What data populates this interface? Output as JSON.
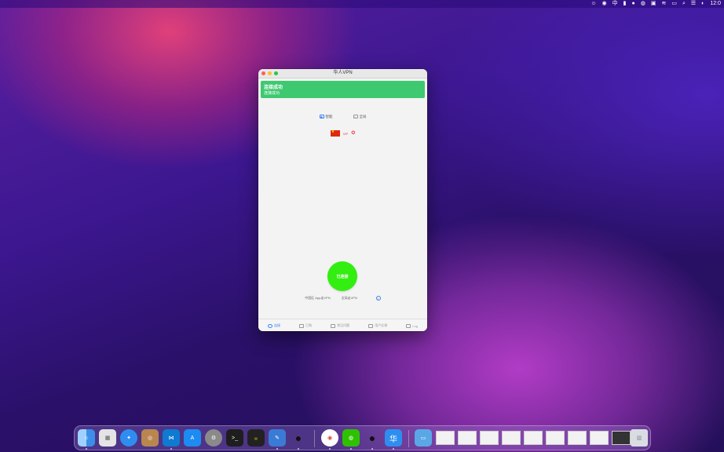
{
  "menubar": {
    "input_method": "中",
    "clock": "12:0"
  },
  "window": {
    "title": "华人VPN",
    "banner": {
      "title": "连接成功",
      "subtitle": "连接成功"
    },
    "modes": [
      {
        "label": "智能",
        "icon": "smart-mode-icon",
        "selected": true
      },
      {
        "label": "全局",
        "icon": "global-mode-icon",
        "selected": false
      }
    ],
    "server": {
      "country_flag": "china-flag-icon",
      "label": "VIP"
    },
    "connect_button": {
      "label": "已连接"
    },
    "hints": [
      {
        "label": "中国区 App走VPN"
      },
      {
        "label": "全局走VPN"
      }
    ],
    "tabs": [
      {
        "label": "连接",
        "active": true
      },
      {
        "label": "已购"
      },
      {
        "label": "常见问题"
      },
      {
        "label": "用户反馈"
      },
      {
        "label": "Log"
      }
    ]
  },
  "dock": {
    "colors": {
      "finder": "#3b8fe8",
      "launchpad": "#e4e4e4",
      "safari": "#2f8df0",
      "vscode": "#0e7ad1",
      "appstore": "#1c8cf2",
      "settings": "#8a8a8a",
      "terminal": "#1e1e1e",
      "chrome": "#ffffff",
      "wechat": "#2dc100",
      "huaren": "#2d8ef0",
      "trash": "#d9dde3"
    },
    "huaren_label": "华"
  }
}
